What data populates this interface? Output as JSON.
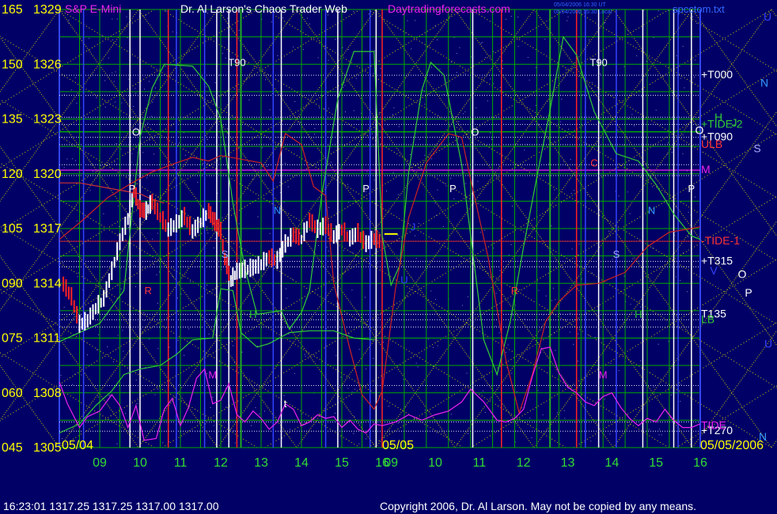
{
  "title": {
    "instrument": "S&P E-Mini",
    "author": "Dr. Al Larson's Chaos Trader Web",
    "site": "Daytradingforecasts.com",
    "stamp1": "05/04/2006 16:30 UT",
    "stamp2": "05/04/2006 15:30 Local",
    "file": "spcctom.txt"
  },
  "footer": {
    "status": "16:23:01  1317.25 1317.25 1317.00 1317.00",
    "copyright": "Copyright 2006, Dr. Al Larson. May not be copied by any means."
  },
  "colors": {
    "background": "#000066",
    "grid": "#00aa00",
    "price_up": "#ffffff",
    "price_down": "#ff2222",
    "pink_line": "#ee22ee",
    "green_line": "#33cc33",
    "red_line": "#cc2222",
    "tide_line": "#cc3333",
    "yellow_diag": "#cccc00",
    "white_vline": "#ffffff",
    "blue_vline": "#3344ff",
    "red_vline": "#ff2222"
  },
  "chart_data": {
    "type": "line",
    "y_left_degree": [
      "165",
      "150",
      "135",
      "120",
      "105",
      "090",
      "075",
      "060",
      "045"
    ],
    "y_left_price": [
      "1329",
      "1326",
      "1323",
      "1320",
      "1317",
      "1314",
      "1311",
      "1308",
      "1305"
    ],
    "ylim": [
      1305,
      1329
    ],
    "x_hour_labels": [
      "09",
      "10",
      "11",
      "12",
      "13",
      "14",
      "15",
      "16",
      "09",
      "10",
      "11",
      "12",
      "13",
      "14",
      "15",
      "16"
    ],
    "date_labels": {
      "start": "05/04",
      "mid": "05/05",
      "end": "05/05/2006"
    },
    "right_levels": [
      {
        "label": "+T000",
        "price": 1325.4,
        "color": "#ffffff"
      },
      {
        "label": "+TIDE-2",
        "price": 1322.7,
        "color": "#33cc33"
      },
      {
        "label": "+T090",
        "price": 1322.0,
        "color": "#ffffff"
      },
      {
        "label": "ULB",
        "price": 1321.6,
        "color": "#ff3333"
      },
      {
        "label": "M",
        "price": 1320.2,
        "color": "#ee22ee"
      },
      {
        "label": "-TIDE-1",
        "price": 1316.3,
        "color": "#ff3333"
      },
      {
        "label": "+T315",
        "price": 1315.2,
        "color": "#ffffff"
      },
      {
        "label": "T135",
        "price": 1312.3,
        "color": "#ffffff"
      },
      {
        "label": "LB",
        "price": 1312.0,
        "color": "#33cc33"
      },
      {
        "label": "+T270",
        "price": 1305.9,
        "color": "#ffffff"
      },
      {
        "label": "TIDE",
        "price": 1306.2,
        "color": "#ee22ee"
      }
    ],
    "right_letters": [
      {
        "t": "U",
        "color": "#3344ff"
      },
      {
        "t": "N",
        "color": "#3399ff"
      },
      {
        "t": "H",
        "color": "#33cc33"
      },
      {
        "t": "J",
        "color": "#33cc33"
      },
      {
        "t": "O",
        "color": "#ffffff"
      },
      {
        "t": "S",
        "color": "#aaaaff"
      },
      {
        "t": "V",
        "color": "#3344ff"
      },
      {
        "t": "O",
        "color": "#ffffff"
      },
      {
        "t": "P",
        "color": "#ffffff"
      },
      {
        "t": "U",
        "color": "#3344ff"
      },
      {
        "t": "N",
        "color": "#3399ff"
      }
    ],
    "markers": [
      {
        "t": "T90",
        "color": "#ffffff"
      },
      {
        "t": "T90",
        "color": "#ffffff"
      },
      {
        "t": "O",
        "color": "#ffffff"
      },
      {
        "t": "O",
        "color": "#ffffff"
      },
      {
        "t": "P",
        "color": "#ffffff"
      },
      {
        "t": "P",
        "color": "#ffffff"
      },
      {
        "t": "P",
        "color": "#ffffff"
      },
      {
        "t": "P",
        "color": "#ffffff"
      },
      {
        "t": "N",
        "color": "#3399ff"
      },
      {
        "t": "N",
        "color": "#3399ff"
      },
      {
        "t": "S",
        "color": "#aaaaff"
      },
      {
        "t": "S",
        "color": "#aaaaff"
      },
      {
        "t": "H",
        "color": "#33cc33"
      },
      {
        "t": "H",
        "color": "#33cc33"
      },
      {
        "t": "M",
        "color": "#ee22ee"
      },
      {
        "t": "M",
        "color": "#ee22ee"
      },
      {
        "t": "J",
        "color": "#3344ff"
      },
      {
        "t": "U",
        "color": "#3344ff"
      },
      {
        "t": "R",
        "color": "#ff3333"
      },
      {
        "t": "R",
        "color": "#ff3333"
      },
      {
        "t": "C",
        "color": "#ff3333"
      },
      {
        "t": "t",
        "color": "#ffffff"
      }
    ],
    "price_series": [
      [
        8.1,
        1313.9
      ],
      [
        8.3,
        1313.2
      ],
      [
        8.5,
        1311.7
      ],
      [
        8.7,
        1311.9
      ],
      [
        8.9,
        1312.6
      ],
      [
        9.1,
        1313.1
      ],
      [
        9.3,
        1314.6
      ],
      [
        9.5,
        1316.2
      ],
      [
        9.7,
        1317.5
      ],
      [
        9.85,
        1319.0
      ],
      [
        10.0,
        1318.0
      ],
      [
        10.15,
        1317.9
      ],
      [
        10.3,
        1318.4
      ],
      [
        10.5,
        1317.6
      ],
      [
        10.7,
        1316.9
      ],
      [
        10.9,
        1317.2
      ],
      [
        11.1,
        1317.6
      ],
      [
        11.3,
        1316.8
      ],
      [
        11.5,
        1317.3
      ],
      [
        11.7,
        1317.9
      ],
      [
        11.85,
        1317.3
      ],
      [
        12.0,
        1316.8
      ],
      [
        12.1,
        1315.3
      ],
      [
        12.25,
        1314.1
      ],
      [
        12.4,
        1314.6
      ],
      [
        12.6,
        1314.7
      ],
      [
        12.8,
        1314.8
      ],
      [
        13.0,
        1315.0
      ],
      [
        13.2,
        1315.4
      ],
      [
        13.4,
        1315.2
      ],
      [
        13.6,
        1316.1
      ],
      [
        13.8,
        1316.6
      ],
      [
        14.0,
        1316.4
      ],
      [
        14.2,
        1317.4
      ],
      [
        14.4,
        1316.9
      ],
      [
        14.6,
        1317.1
      ],
      [
        14.8,
        1316.5
      ],
      [
        15.0,
        1316.9
      ],
      [
        15.2,
        1316.4
      ],
      [
        15.4,
        1316.7
      ],
      [
        15.6,
        1316.1
      ],
      [
        15.8,
        1316.4
      ],
      [
        16.0,
        1316.2
      ]
    ],
    "series": [
      {
        "values": [
          [
            8.0,
            1310.8
          ],
          [
            9.0,
            1311.8
          ],
          [
            9.6,
            1313.6
          ],
          [
            10.0,
            1322.0
          ],
          [
            10.3,
            1324.7
          ],
          [
            10.6,
            1326.0
          ],
          [
            11.3,
            1325.9
          ],
          [
            11.7,
            1324.8
          ],
          [
            12.0,
            1323.0
          ],
          [
            12.3,
            1318.4
          ],
          [
            12.6,
            1314.8
          ],
          [
            12.9,
            1312.3
          ],
          [
            13.2,
            1312.4
          ],
          [
            13.5,
            1312.5
          ],
          [
            13.7,
            1311.5
          ],
          [
            14.0,
            1312.4
          ],
          [
            14.2,
            1313.6
          ],
          [
            14.5,
            1318.8
          ],
          [
            14.9,
            1324.1
          ],
          [
            15.3,
            1326.7
          ],
          [
            15.8,
            1326.7
          ],
          [
            16.0,
            1316.6
          ],
          [
            16.2,
            1313.9
          ],
          [
            16.4,
            1315.0
          ],
          [
            16.6,
            1320.1
          ],
          [
            16.9,
            1324.6
          ],
          [
            17.1,
            1326.1
          ],
          [
            17.4,
            1325.4
          ],
          [
            17.8,
            1320.5
          ],
          [
            18.3,
            1310.9
          ],
          [
            18.6,
            1309.0
          ],
          [
            18.9,
            1311.9
          ],
          [
            19.2,
            1316.0
          ],
          [
            19.5,
            1319.8
          ],
          [
            19.8,
            1323.5
          ],
          [
            20.1,
            1327.5
          ],
          [
            20.4,
            1326.5
          ],
          [
            20.8,
            1323.4
          ],
          [
            21.3,
            1321.1
          ],
          [
            21.8,
            1320.7
          ],
          [
            22.2,
            1319.4
          ],
          [
            22.6,
            1317.8
          ],
          [
            23.0,
            1316.6
          ],
          [
            23.2,
            1316.4
          ]
        ]
      },
      {
        "values": [
          [
            8.0,
            1316.4
          ],
          [
            8.6,
            1317.5
          ],
          [
            9.2,
            1318.7
          ],
          [
            9.8,
            1319.5
          ],
          [
            10.3,
            1320.1
          ],
          [
            10.9,
            1320.6
          ],
          [
            11.3,
            1320.9
          ],
          [
            11.7,
            1320.7
          ],
          [
            12.0,
            1321.0
          ],
          [
            12.5,
            1320.8
          ],
          [
            13.0,
            1320.6
          ],
          [
            13.3,
            1319.6
          ],
          [
            13.6,
            1322.2
          ],
          [
            14.0,
            1321.6
          ],
          [
            14.3,
            1319.3
          ],
          [
            14.6,
            1318.8
          ],
          [
            14.8,
            1314.0
          ],
          [
            15.2,
            1310.4
          ],
          [
            15.5,
            1307.9
          ],
          [
            15.8,
            1307.1
          ],
          [
            16.0,
            1308.1
          ],
          [
            16.3,
            1313.7
          ],
          [
            16.6,
            1317.6
          ],
          [
            17.0,
            1320.6
          ],
          [
            17.5,
            1322.2
          ],
          [
            17.8,
            1322.0
          ],
          [
            18.0,
            1319.7
          ],
          [
            18.4,
            1315.4
          ],
          [
            18.8,
            1309.8
          ],
          [
            19.1,
            1306.9
          ],
          [
            19.4,
            1309.0
          ],
          [
            19.7,
            1311.9
          ],
          [
            20.0,
            1313.0
          ],
          [
            20.4,
            1313.9
          ],
          [
            20.9,
            1314.0
          ],
          [
            21.5,
            1314.6
          ],
          [
            22.0,
            1316.0
          ],
          [
            22.5,
            1316.8
          ],
          [
            23.0,
            1317.0
          ],
          [
            23.2,
            1317.1
          ]
        ]
      },
      {
        "values": [
          [
            8.0,
            1305.8
          ],
          [
            8.5,
            1306.3
          ],
          [
            8.9,
            1307.3
          ],
          [
            9.3,
            1308.1
          ],
          [
            9.6,
            1309.0
          ],
          [
            10.0,
            1309.3
          ],
          [
            10.5,
            1309.5
          ],
          [
            10.9,
            1310.1
          ],
          [
            11.3,
            1310.9
          ],
          [
            11.8,
            1311.0
          ],
          [
            12.0,
            1313.7
          ],
          [
            12.3,
            1313.6
          ],
          [
            12.5,
            1311.3
          ],
          [
            12.9,
            1310.5
          ],
          [
            13.2,
            1310.7
          ],
          [
            13.7,
            1311.3
          ],
          [
            14.2,
            1311.4
          ],
          [
            14.8,
            1311.4
          ],
          [
            15.3,
            1311.0
          ],
          [
            15.8,
            1310.9
          ]
        ]
      },
      {
        "values": [
          [
            8.0,
            1319.5
          ],
          [
            8.5,
            1319.5
          ],
          [
            9.0,
            1319.3
          ],
          [
            9.5,
            1319.1
          ],
          [
            10.0,
            1318.9
          ],
          [
            10.3,
            1318.6
          ],
          [
            10.6,
            1318.4
          ]
        ]
      },
      {
        "values": [
          [
            8.0,
            1308.6
          ],
          [
            8.2,
            1307.4
          ],
          [
            8.5,
            1306.1
          ],
          [
            8.7,
            1306.7
          ],
          [
            9.0,
            1307.0
          ],
          [
            9.3,
            1307.9
          ],
          [
            9.5,
            1307.3
          ],
          [
            9.7,
            1306.1
          ],
          [
            9.9,
            1307.3
          ],
          [
            10.1,
            1305.4
          ],
          [
            10.4,
            1305.5
          ],
          [
            10.6,
            1307.1
          ],
          [
            10.8,
            1307.7
          ],
          [
            11.0,
            1306.2
          ],
          [
            11.2,
            1307.2
          ],
          [
            11.4,
            1308.8
          ],
          [
            11.6,
            1309.3
          ],
          [
            11.8,
            1307.4
          ],
          [
            12.0,
            1307.6
          ],
          [
            12.2,
            1308.5
          ],
          [
            12.4,
            1306.8
          ],
          [
            12.6,
            1306.4
          ],
          [
            12.8,
            1307.0
          ],
          [
            13.0,
            1306.6
          ],
          [
            13.2,
            1306.0
          ],
          [
            13.4,
            1306.4
          ],
          [
            13.6,
            1307.4
          ],
          [
            13.8,
            1307.1
          ],
          [
            14.0,
            1306.2
          ],
          [
            14.2,
            1306.4
          ],
          [
            14.4,
            1306.8
          ],
          [
            14.6,
            1306.6
          ],
          [
            14.8,
            1306.7
          ],
          [
            15.0,
            1306.1
          ],
          [
            15.2,
            1306.5
          ],
          [
            15.4,
            1306.0
          ],
          [
            15.6,
            1305.8
          ],
          [
            15.8,
            1306.3
          ],
          [
            16.0,
            1306.2
          ],
          [
            16.3,
            1306.4
          ],
          [
            16.6,
            1306.8
          ],
          [
            16.9,
            1306.5
          ],
          [
            17.2,
            1306.8
          ],
          [
            17.5,
            1307.0
          ],
          [
            17.8,
            1307.5
          ],
          [
            18.0,
            1308.2
          ],
          [
            18.3,
            1307.5
          ],
          [
            18.6,
            1306.5
          ],
          [
            18.8,
            1306.4
          ],
          [
            19.0,
            1306.6
          ],
          [
            19.2,
            1307.1
          ],
          [
            19.4,
            1308.9
          ],
          [
            19.6,
            1310.4
          ],
          [
            19.8,
            1310.5
          ],
          [
            20.0,
            1309.1
          ],
          [
            20.2,
            1308.3
          ],
          [
            20.4,
            1308.0
          ],
          [
            20.6,
            1307.5
          ],
          [
            20.8,
            1307.3
          ],
          [
            21.0,
            1307.8
          ],
          [
            21.2,
            1308.0
          ],
          [
            21.4,
            1307.2
          ],
          [
            21.6,
            1306.6
          ],
          [
            21.8,
            1306.2
          ],
          [
            22.0,
            1306.6
          ],
          [
            22.2,
            1306.4
          ],
          [
            22.4,
            1307.1
          ],
          [
            22.6,
            1306.5
          ],
          [
            22.8,
            1306.1
          ],
          [
            23.0,
            1306.1
          ],
          [
            23.2,
            1306.3
          ]
        ]
      }
    ]
  }
}
